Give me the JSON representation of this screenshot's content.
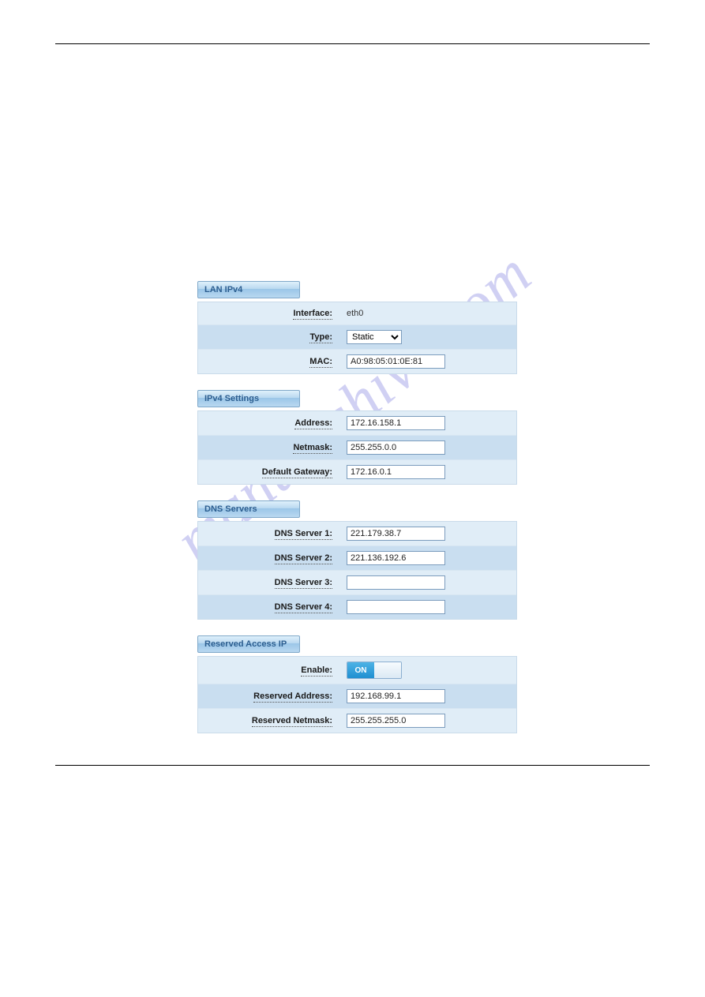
{
  "watermark": "manualshive.com",
  "sections": {
    "lan": {
      "title": "LAN IPv4",
      "interface": {
        "label": "Interface:",
        "value": "eth0"
      },
      "type": {
        "label": "Type:",
        "value": "Static"
      },
      "mac": {
        "label": "MAC:",
        "value": "A0:98:05:01:0E:81"
      }
    },
    "ipv4": {
      "title": "IPv4 Settings",
      "address": {
        "label": "Address:",
        "value": "172.16.158.1"
      },
      "netmask": {
        "label": "Netmask:",
        "value": "255.255.0.0"
      },
      "gateway": {
        "label": "Default Gateway:",
        "value": "172.16.0.1"
      }
    },
    "dns": {
      "title": "DNS Servers",
      "s1": {
        "label": "DNS Server 1:",
        "value": "221.179.38.7"
      },
      "s2": {
        "label": "DNS Server 2:",
        "value": "221.136.192.6"
      },
      "s3": {
        "label": "DNS Server 3:",
        "value": ""
      },
      "s4": {
        "label": "DNS Server 4:",
        "value": ""
      }
    },
    "reserved": {
      "title": "Reserved Access IP",
      "enable": {
        "label": "Enable:",
        "value": "ON"
      },
      "address": {
        "label": "Reserved Address:",
        "value": "192.168.99.1"
      },
      "netmask": {
        "label": "Reserved Netmask:",
        "value": "255.255.255.0"
      }
    }
  }
}
